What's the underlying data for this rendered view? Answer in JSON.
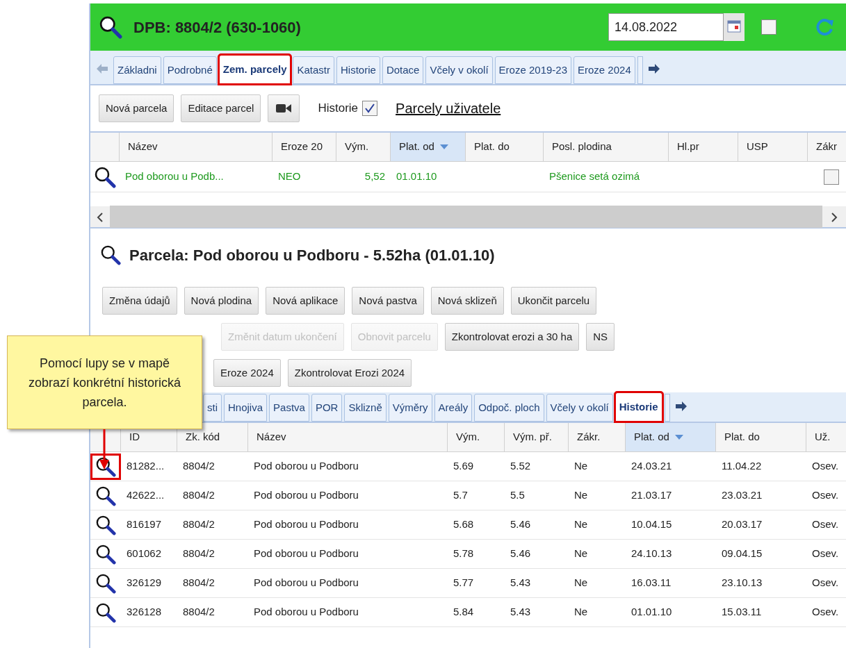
{
  "header": {
    "title": "DPB: 8804/2 (630-1060)",
    "date": "14.08.2022",
    "checkbox_checked": false
  },
  "tabs": [
    {
      "label": "Základni",
      "selected": false,
      "annotated": false
    },
    {
      "label": "Podrobné",
      "selected": false,
      "annotated": false
    },
    {
      "label": "Zem. parcely",
      "selected": true,
      "annotated": true
    },
    {
      "label": "Katastr",
      "selected": false,
      "annotated": false
    },
    {
      "label": "Historie",
      "selected": false,
      "annotated": false
    },
    {
      "label": "Dotace",
      "selected": false,
      "annotated": false
    },
    {
      "label": "Včely v okolí",
      "selected": false,
      "annotated": false
    },
    {
      "label": "Eroze 2019-23",
      "selected": false,
      "annotated": false
    },
    {
      "label": "Eroze 2024",
      "selected": false,
      "annotated": false
    }
  ],
  "toolbar": {
    "buttons": [
      "Nová parcela",
      "Editace parcel"
    ],
    "history_label": "Historie",
    "history_checked": true,
    "link": "Parcely uživatele"
  },
  "parcels_table": {
    "columns": [
      {
        "label": "Název",
        "sorted": false
      },
      {
        "label": "Eroze 20",
        "sorted": false
      },
      {
        "label": "Vým.",
        "sorted": false
      },
      {
        "label": "Plat. od",
        "sorted": true
      },
      {
        "label": "Plat. do",
        "sorted": false
      },
      {
        "label": "Posl. plodina",
        "sorted": false
      },
      {
        "label": "Hl.pr",
        "sorted": false
      },
      {
        "label": "USP",
        "sorted": false
      },
      {
        "label": "Zákr",
        "sorted": false
      }
    ],
    "rows": [
      {
        "cells": [
          "Pod oborou u Podb...",
          "NEO",
          "5,52",
          "01.01.10",
          "",
          "Pšenice setá ozimá",
          "",
          ""
        ],
        "checked": false
      }
    ]
  },
  "parcel": {
    "title": "Parcela: Pod oborou u Podboru - 5.52ha (01.01.10)",
    "button_rows": [
      [
        {
          "label": "Změna údajů",
          "disabled": false
        },
        {
          "label": "Nová plodina",
          "disabled": false
        },
        {
          "label": "Nová aplikace",
          "disabled": false
        },
        {
          "label": "Nová pastva",
          "disabled": false
        },
        {
          "label": "Nová sklizeň",
          "disabled": false
        },
        {
          "label": "Ukončit parcelu",
          "disabled": false
        }
      ],
      [
        {
          "label": "Změnit datum ukončení",
          "disabled": true
        },
        {
          "label": "Obnovit parcelu",
          "disabled": true
        },
        {
          "label": "Zkontrolovat erozi a 30 ha",
          "disabled": false
        },
        {
          "label": "NS",
          "disabled": false
        }
      ],
      [
        {
          "label": "Eroze 2024",
          "disabled": false
        },
        {
          "label": "Zkontrolovat Erozi 2024",
          "disabled": false
        }
      ]
    ]
  },
  "sub_tabs": [
    {
      "label": "sti",
      "selected": false,
      "annotated": false
    },
    {
      "label": "Hnojiva",
      "selected": false,
      "annotated": false
    },
    {
      "label": "Pastva",
      "selected": false,
      "annotated": false
    },
    {
      "label": "POR",
      "selected": false,
      "annotated": false
    },
    {
      "label": "Sklizně",
      "selected": false,
      "annotated": false
    },
    {
      "label": "Výměry",
      "selected": false,
      "annotated": false
    },
    {
      "label": "Areály",
      "selected": false,
      "annotated": false
    },
    {
      "label": "Odpoč. ploch",
      "selected": false,
      "annotated": false
    },
    {
      "label": "Včely v okolí",
      "selected": false,
      "annotated": false
    },
    {
      "label": "Historie",
      "selected": true,
      "annotated": true
    }
  ],
  "history_table": {
    "columns": [
      {
        "label": "ID",
        "sorted": false
      },
      {
        "label": "Zk. kód",
        "sorted": false
      },
      {
        "label": "Název",
        "sorted": false
      },
      {
        "label": "Vým.",
        "sorted": false
      },
      {
        "label": "Vým. př.",
        "sorted": false
      },
      {
        "label": "Zákr.",
        "sorted": false
      },
      {
        "label": "Plat. od",
        "sorted": true
      },
      {
        "label": "Plat. do",
        "sorted": false
      },
      {
        "label": "Už.",
        "sorted": false
      }
    ],
    "rows": [
      {
        "cells": [
          "81282...",
          "8804/2",
          "Pod oborou u Podboru",
          "5.69",
          "5.52",
          "Ne",
          "24.03.21",
          "11.04.22",
          "Osev."
        ],
        "annotated": true
      },
      {
        "cells": [
          "42622...",
          "8804/2",
          "Pod oborou u Podboru",
          "5.7",
          "5.5",
          "Ne",
          "21.03.17",
          "23.03.21",
          "Osev."
        ],
        "annotated": false
      },
      {
        "cells": [
          "816197",
          "8804/2",
          "Pod oborou u Podboru",
          "5.68",
          "5.46",
          "Ne",
          "10.04.15",
          "20.03.17",
          "Osev."
        ],
        "annotated": false
      },
      {
        "cells": [
          "601062",
          "8804/2",
          "Pod oborou u Podboru",
          "5.78",
          "5.46",
          "Ne",
          "24.10.13",
          "09.04.15",
          "Osev."
        ],
        "annotated": false
      },
      {
        "cells": [
          "326129",
          "8804/2",
          "Pod oborou u Podboru",
          "5.77",
          "5.43",
          "Ne",
          "16.03.11",
          "23.10.13",
          "Osev."
        ],
        "annotated": false
      },
      {
        "cells": [
          "326128",
          "8804/2",
          "Pod oborou u Podboru",
          "5.84",
          "5.43",
          "Ne",
          "01.01.10",
          "15.03.11",
          "Osev."
        ],
        "annotated": false
      }
    ]
  },
  "callout": {
    "text": "Pomocí lupy se v mapě zobrazí konkrétní historická parcela."
  }
}
